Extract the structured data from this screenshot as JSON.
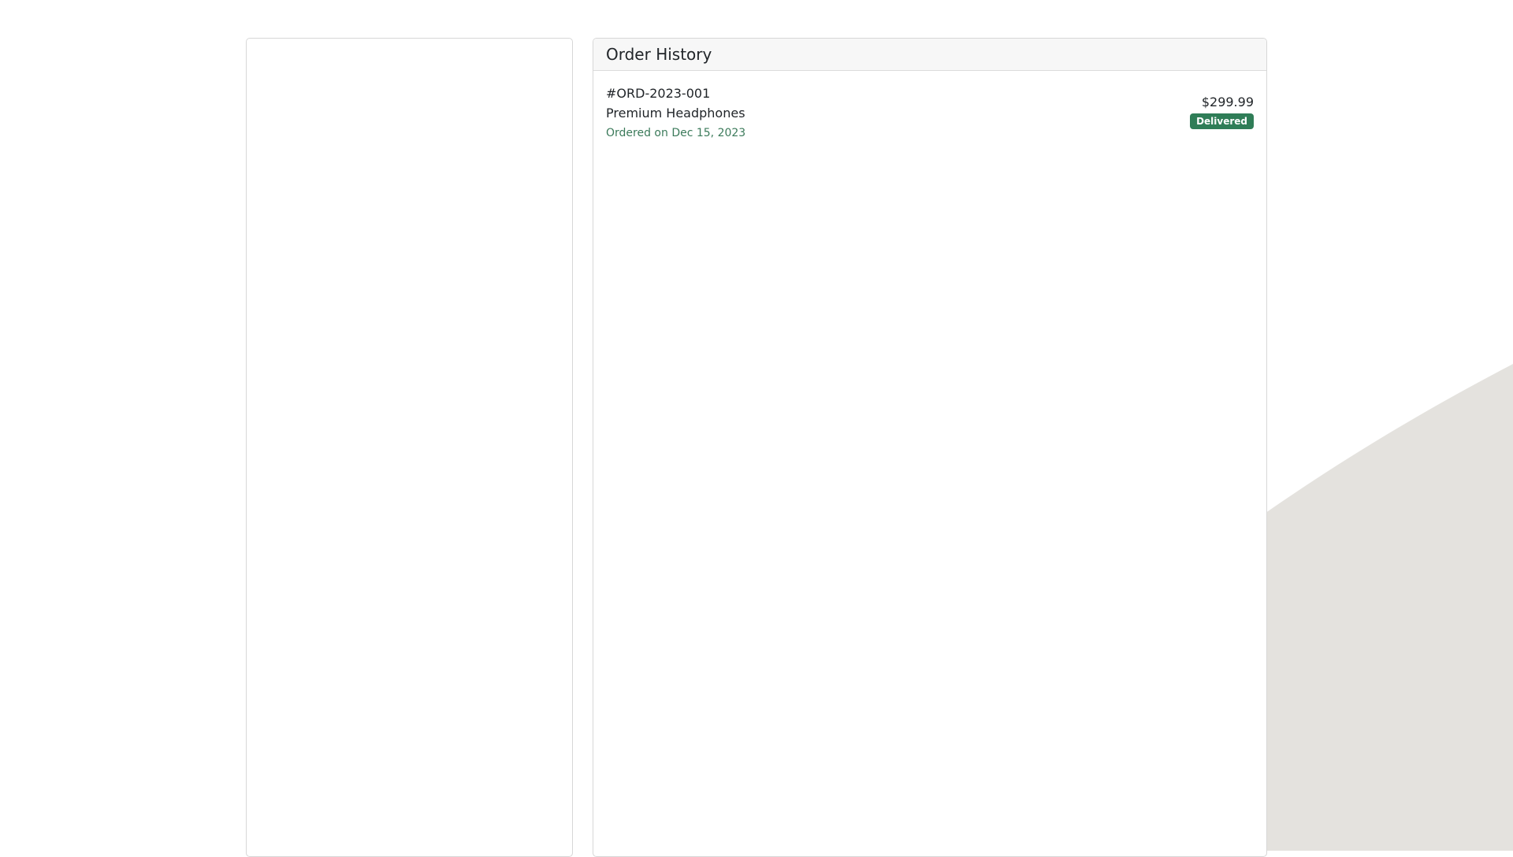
{
  "orders_panel": {
    "title": "Order History",
    "orders": [
      {
        "id": "#ORD-2023-001",
        "product": "Premium Headphones",
        "date": "Ordered on Dec 15, 2023",
        "price": "$299.99",
        "status": "Delivered"
      }
    ]
  },
  "colors": {
    "page_background": "#ffffff",
    "decoration": "#e4e2de",
    "panel_border": "#d7d7d7",
    "card_header_background": "#f7f7f7",
    "date_text": "#3b7a5a",
    "status_delivered": "#2f7d57"
  }
}
